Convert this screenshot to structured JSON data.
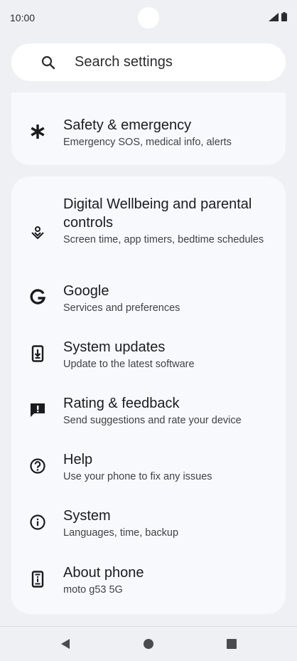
{
  "status": {
    "time": "10:00"
  },
  "search": {
    "placeholder": "Search settings"
  },
  "items": [
    {
      "title": "Safety & emergency",
      "subtitle": "Emergency SOS, medical info, alerts",
      "icon": "asterisk-icon"
    },
    {
      "title": "Digital Wellbeing and parental controls",
      "subtitle": "Screen time, app timers, bedtime schedules",
      "icon": "wellbeing-icon"
    },
    {
      "title": "Google",
      "subtitle": "Services and preferences",
      "icon": "google-icon"
    },
    {
      "title": "System updates",
      "subtitle": "Update to the latest software",
      "icon": "system-update-icon"
    },
    {
      "title": "Rating & feedback",
      "subtitle": "Send suggestions and rate your device",
      "icon": "feedback-icon"
    },
    {
      "title": "Help",
      "subtitle": "Use your phone to fix any issues",
      "icon": "help-icon"
    },
    {
      "title": "System",
      "subtitle": "Languages, time, backup",
      "icon": "info-icon"
    },
    {
      "title": "About phone",
      "subtitle": "moto g53 5G",
      "icon": "phone-info-icon"
    }
  ],
  "colors": {
    "background": "#eef0f3",
    "card": "#f8f9fc",
    "search": "#ffffff",
    "text": "#1b1c1e"
  }
}
